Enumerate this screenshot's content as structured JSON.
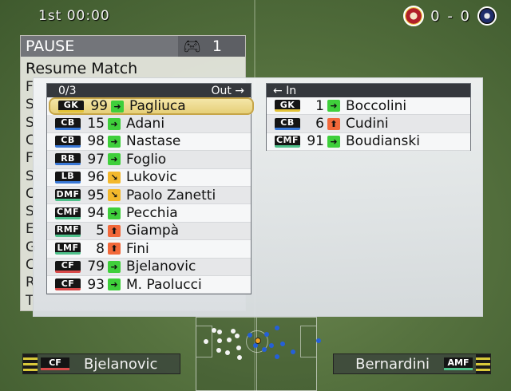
{
  "hud": {
    "time": "1st 00:00",
    "score": "0 - 0",
    "home_crest": "home-crest-icon",
    "away_crest": "away-crest-icon"
  },
  "pause_menu": {
    "title": "PAUSE",
    "controller_count": "1",
    "controller_icon": "gamepad-icon",
    "first_item": "Resume Match",
    "partial_letters": [
      "F",
      "S",
      "S",
      "C",
      "F",
      "S",
      "C",
      "S",
      "E",
      "G",
      "C",
      "R",
      "T"
    ]
  },
  "out_list": {
    "counter": "0/3",
    "header": "Out →",
    "players": [
      {
        "pos": "GK",
        "num": "99",
        "arrow": "flat",
        "name": "Pagliuca",
        "selected": true
      },
      {
        "pos": "CB",
        "num": "15",
        "arrow": "flat",
        "name": "Adani"
      },
      {
        "pos": "CB",
        "num": "98",
        "arrow": "flat",
        "name": "Nastase"
      },
      {
        "pos": "RB",
        "num": "97",
        "arrow": "flat",
        "name": "Foglio"
      },
      {
        "pos": "LB",
        "num": "96",
        "arrow": "down",
        "name": "Lukovic"
      },
      {
        "pos": "DMF",
        "num": "95",
        "arrow": "down",
        "name": "Paolo Zanetti"
      },
      {
        "pos": "CMF",
        "num": "94",
        "arrow": "flat",
        "name": "Pecchia"
      },
      {
        "pos": "RMF",
        "num": "5",
        "arrow": "up",
        "name": "Giampà"
      },
      {
        "pos": "LMF",
        "num": "8",
        "arrow": "up",
        "name": "Fini"
      },
      {
        "pos": "CF",
        "num": "79",
        "arrow": "flat",
        "name": "Bjelanovic"
      },
      {
        "pos": "CF",
        "num": "93",
        "arrow": "flat",
        "name": "M. Paolucci"
      }
    ]
  },
  "in_list": {
    "header": "← In",
    "players": [
      {
        "pos": "GK",
        "num": "1",
        "arrow": "flat",
        "name": "Boccolini"
      },
      {
        "pos": "CB",
        "num": "6",
        "arrow": "up",
        "name": "Cudini"
      },
      {
        "pos": "CMF",
        "num": "91",
        "arrow": "flat",
        "name": "Boudianski"
      }
    ]
  },
  "bottom": {
    "left_pos": "CF",
    "left_name": "Bjelanovic",
    "right_pos": "AMF",
    "right_name": "Bernardini"
  },
  "colors": {
    "gk": "#e3c338",
    "defender": "#3a78d6",
    "midfielder": "#4ec08a",
    "forward": "#d94a4a",
    "arrow_flat": "#3fcf3b",
    "arrow_up": "#f2683a",
    "arrow_down": "#f3b82c"
  }
}
